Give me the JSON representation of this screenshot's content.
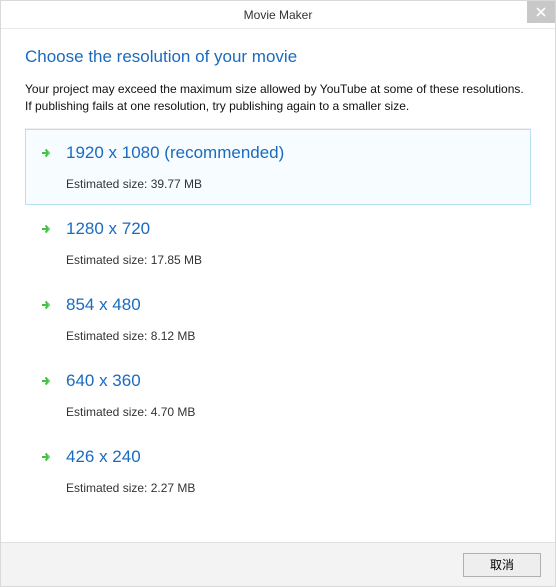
{
  "window": {
    "title": "Movie Maker"
  },
  "heading": "Choose the resolution of your movie",
  "description": "Your project may exceed the maximum size allowed by YouTube at some of these resolutions.  If publishing fails at one resolution, try publishing again to a smaller size.",
  "options": [
    {
      "label": "1920 x 1080 (recommended)",
      "sub": "Estimated size: 39.77 MB",
      "selected": true
    },
    {
      "label": "1280 x 720",
      "sub": "Estimated size: 17.85 MB",
      "selected": false
    },
    {
      "label": "854 x 480",
      "sub": "Estimated size: 8.12 MB",
      "selected": false
    },
    {
      "label": "640 x 360",
      "sub": "Estimated size: 4.70 MB",
      "selected": false
    },
    {
      "label": "426 x 240",
      "sub": "Estimated size: 2.27 MB",
      "selected": false
    }
  ],
  "footer": {
    "cancel_label": "取消"
  }
}
